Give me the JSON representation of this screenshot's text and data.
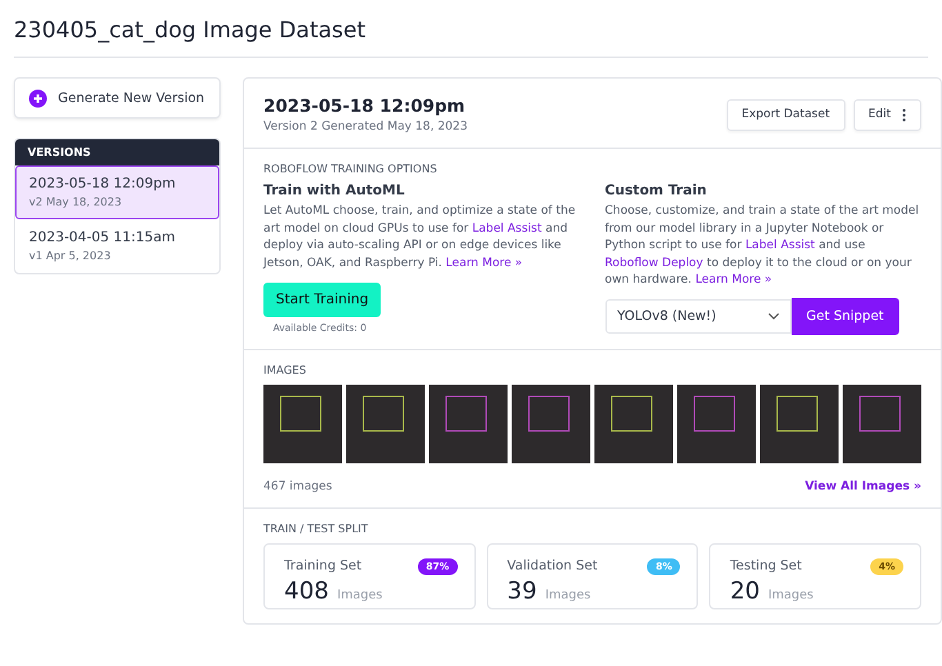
{
  "page_title": "230405_cat_dog Image Dataset",
  "generate_button": {
    "label": "Generate New Version"
  },
  "versions": {
    "heading": "VERSIONS",
    "items": [
      {
        "title": "2023-05-18 12:09pm",
        "subtitle": "v2 May 18, 2023",
        "selected": true
      },
      {
        "title": "2023-04-05 11:15am",
        "subtitle": "v1 Apr 5, 2023",
        "selected": false
      }
    ]
  },
  "version_header": {
    "title": "2023-05-18 12:09pm",
    "subtitle": "Version 2 Generated May 18, 2023",
    "buttons": [
      {
        "label": "Export Dataset",
        "kind": "plain"
      },
      {
        "label": "Edit",
        "kind": "menu"
      }
    ]
  },
  "training": {
    "heading": "ROBOFLOW TRAINING OPTIONS",
    "automl": {
      "title": "Train with AutoML",
      "text": [
        {
          "kind": "text",
          "text": "Let AutoML choose, train, and optimize a state of the art model on cloud GPUs to use for "
        },
        {
          "kind": "link",
          "text": "Label Assist"
        },
        {
          "kind": "text",
          "text": " and deploy via auto-scaling API or on edge devices like Jetson, OAK, and Raspberry Pi. "
        },
        {
          "kind": "link",
          "text": "Learn More »"
        }
      ],
      "button": "Start Training",
      "credits": "Available Credits: 0"
    },
    "custom": {
      "title": "Custom Train",
      "text": [
        {
          "kind": "text",
          "text": "Choose, customize, and train a state of the art model from our model library in a Jupyter Notebook or Python script to use for "
        },
        {
          "kind": "link",
          "text": "Label Assist"
        },
        {
          "kind": "text",
          "text": " and use "
        },
        {
          "kind": "link",
          "text": "Roboflow Deploy"
        },
        {
          "kind": "text",
          "text": " to deploy it to the cloud or on your own hardware. "
        },
        {
          "kind": "link",
          "text": "Learn More »"
        }
      ],
      "model_select": "YOLOv8 (New!)",
      "button": "Get Snippet"
    }
  },
  "images": {
    "heading": "IMAGES",
    "count": "467 images",
    "link": "View All Images »",
    "thumbnails": [
      {
        "color": "#a8b84a"
      },
      {
        "color": "#a8b84a"
      },
      {
        "color": "#b04ab8"
      },
      {
        "color": "#b04ab8"
      },
      {
        "color": "#a8b84a"
      },
      {
        "color": "#b04ab8"
      },
      {
        "color": "#a8b84a"
      },
      {
        "color": "#b04ab8"
      }
    ]
  },
  "split": {
    "heading": "TRAIN / TEST SPLIT",
    "sets": [
      {
        "name": "Training Set",
        "percent": "87%",
        "color": "#8315f9",
        "count": "408",
        "unit": "Images"
      },
      {
        "name": "Validation Set",
        "percent": "8%",
        "color": "#3fbdf5",
        "count": "39",
        "unit": "Images"
      },
      {
        "name": "Testing Set",
        "percent": "4%",
        "color": "#fcd34d",
        "count": "20",
        "unit": "Images"
      }
    ]
  }
}
